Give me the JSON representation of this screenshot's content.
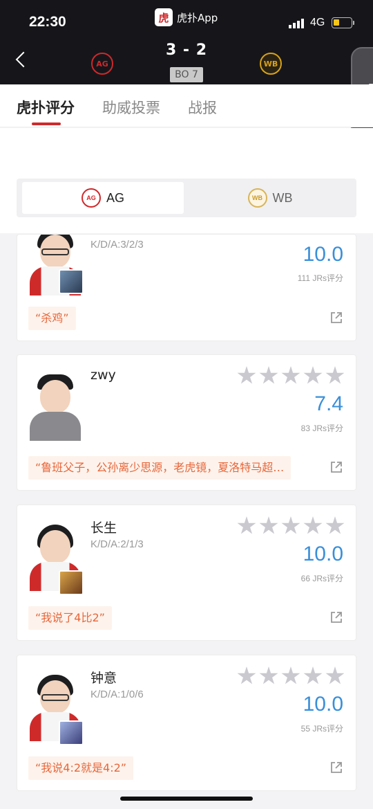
{
  "status": {
    "time": "22:30",
    "network": "4G",
    "battery_level": 0.35
  },
  "app": {
    "name": "虎扑App",
    "logo_char": "虎"
  },
  "match": {
    "score": "3 - 2",
    "format": "BO 7",
    "home_logo_text": "AG",
    "away_logo_text": "WB",
    "home_color": "#d0282b",
    "away_color": "#d8a218"
  },
  "tabs": [
    {
      "label": "虎扑评分",
      "active": true
    },
    {
      "label": "助威投票",
      "active": false
    },
    {
      "label": "战报",
      "active": false
    }
  ],
  "team_toggle": {
    "selected": "AG",
    "options": [
      {
        "label": "AG",
        "logo_text": "AG"
      },
      {
        "label": "WB",
        "logo_text": "WB"
      }
    ]
  },
  "side_handle": {
    "icon": "chevron-left-icon",
    "glyph": "❬"
  },
  "players": [
    {
      "name": "",
      "kda": "K/D/A:3/2/3",
      "rating": "10.0",
      "votes": "111 JRs评分",
      "quote": "“杀鸡”",
      "stars": 5
    },
    {
      "name": "zwy",
      "kda": "",
      "rating": "7.4",
      "votes": "83 JRs评分",
      "quote": "“鲁班父子，公孙离少思源，老虎镜，夏洛特马超…",
      "stars": 5
    },
    {
      "name": "长生",
      "kda": "K/D/A:2/1/3",
      "rating": "10.0",
      "votes": "66 JRs评分",
      "quote": "“我说了4比2”",
      "stars": 5
    },
    {
      "name": "钟意",
      "kda": "K/D/A:1/0/6",
      "rating": "10.0",
      "votes": "55 JRs评分",
      "quote": "“我说4:2就是4:2”",
      "stars": 5
    }
  ]
}
